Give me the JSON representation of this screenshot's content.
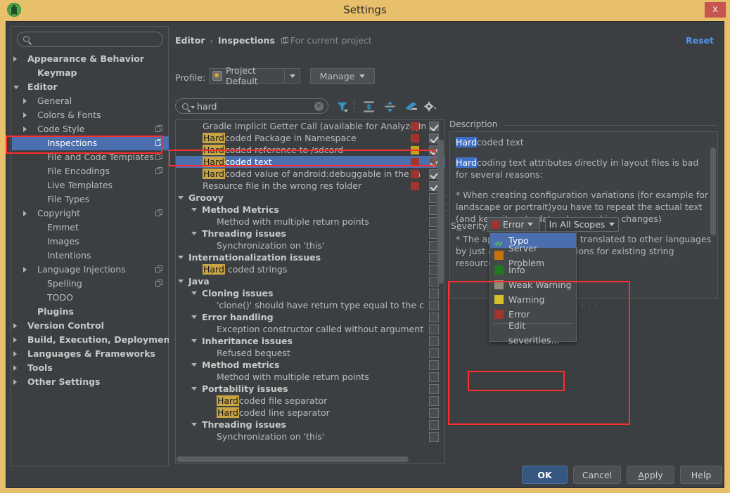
{
  "window": {
    "title": "Settings",
    "close_label": "x",
    "app_icon": "android-studio-icon"
  },
  "sidebar": {
    "search_placeholder": "",
    "items": [
      {
        "label": "Appearance & Behavior",
        "level": 0,
        "arrow": "right",
        "bold": true,
        "copy": false,
        "selected": false
      },
      {
        "label": "Keymap",
        "level": 1,
        "arrow": "",
        "bold": true,
        "copy": false,
        "selected": false
      },
      {
        "label": "Editor",
        "level": 0,
        "arrow": "down",
        "bold": true,
        "copy": false,
        "selected": false
      },
      {
        "label": "General",
        "level": 1,
        "arrow": "right",
        "bold": false,
        "copy": false,
        "selected": false
      },
      {
        "label": "Colors & Fonts",
        "level": 1,
        "arrow": "right",
        "bold": false,
        "copy": false,
        "selected": false
      },
      {
        "label": "Code Style",
        "level": 1,
        "arrow": "right",
        "bold": false,
        "copy": true,
        "selected": false
      },
      {
        "label": "Inspections",
        "level": 2,
        "arrow": "",
        "bold": false,
        "copy": true,
        "selected": true
      },
      {
        "label": "File and Code Templates",
        "level": 2,
        "arrow": "",
        "bold": false,
        "copy": true,
        "selected": false
      },
      {
        "label": "File Encodings",
        "level": 2,
        "arrow": "",
        "bold": false,
        "copy": true,
        "selected": false
      },
      {
        "label": "Live Templates",
        "level": 2,
        "arrow": "",
        "bold": false,
        "copy": false,
        "selected": false
      },
      {
        "label": "File Types",
        "level": 2,
        "arrow": "",
        "bold": false,
        "copy": false,
        "selected": false
      },
      {
        "label": "Copyright",
        "level": 1,
        "arrow": "right",
        "bold": false,
        "copy": true,
        "selected": false
      },
      {
        "label": "Emmet",
        "level": 2,
        "arrow": "",
        "bold": false,
        "copy": false,
        "selected": false
      },
      {
        "label": "Images",
        "level": 2,
        "arrow": "",
        "bold": false,
        "copy": false,
        "selected": false
      },
      {
        "label": "Intentions",
        "level": 2,
        "arrow": "",
        "bold": false,
        "copy": false,
        "selected": false
      },
      {
        "label": "Language Injections",
        "level": 1,
        "arrow": "right",
        "bold": false,
        "copy": true,
        "selected": false
      },
      {
        "label": "Spelling",
        "level": 2,
        "arrow": "",
        "bold": false,
        "copy": true,
        "selected": false
      },
      {
        "label": "TODO",
        "level": 2,
        "arrow": "",
        "bold": false,
        "copy": false,
        "selected": false
      },
      {
        "label": "Plugins",
        "level": 1,
        "arrow": "",
        "bold": true,
        "copy": false,
        "selected": false
      },
      {
        "label": "Version Control",
        "level": 0,
        "arrow": "right",
        "bold": true,
        "copy": false,
        "selected": false
      },
      {
        "label": "Build, Execution, Deployment",
        "level": 0,
        "arrow": "right",
        "bold": true,
        "copy": false,
        "selected": false
      },
      {
        "label": "Languages & Frameworks",
        "level": 0,
        "arrow": "right",
        "bold": true,
        "copy": false,
        "selected": false
      },
      {
        "label": "Tools",
        "level": 0,
        "arrow": "right",
        "bold": true,
        "copy": false,
        "selected": false
      },
      {
        "label": "Other Settings",
        "level": 0,
        "arrow": "right",
        "bold": true,
        "copy": false,
        "selected": false
      }
    ]
  },
  "main": {
    "breadcrumb": {
      "root": "Editor",
      "separator": "›",
      "current": "Inspections",
      "scope": "For current project"
    },
    "reset_label": "Reset",
    "profile": {
      "label": "Profile:",
      "value": "Project Default",
      "manage_label": "Manage"
    },
    "search": {
      "value": "hard",
      "clear_label": "✕"
    },
    "toolbar_icons": [
      "filter-icon",
      "expand-all-icon",
      "collapse-all-icon",
      "eraser-icon",
      "gear-icon"
    ]
  },
  "inspection_tree": [
    {
      "label": "Gradle Implicit Getter Call (available for Analyze|In",
      "indent": 38,
      "group": false,
      "arrow": "",
      "hl": "",
      "sev": "#a0342f",
      "check": "on",
      "selected": false
    },
    {
      "label": "coded Package in Namespace",
      "indent": 38,
      "group": false,
      "arrow": "",
      "hl": "Hard",
      "sev": "#a0342f",
      "check": "on",
      "selected": false
    },
    {
      "label": "coded reference to /sdcard",
      "indent": 38,
      "group": false,
      "arrow": "",
      "hl": "Hard",
      "sev": "#c9a21e",
      "check": "on",
      "selected": false
    },
    {
      "label": "coded text",
      "indent": 38,
      "group": false,
      "arrow": "",
      "hl": "Hard",
      "sev": "#a0342f",
      "check": "on",
      "selected": true
    },
    {
      "label": "coded value of android:debuggable in the m",
      "indent": 38,
      "group": false,
      "arrow": "",
      "hl": "Hard",
      "sev": "#a0342f",
      "check": "on",
      "selected": false
    },
    {
      "label": "Resource file in the wrong res folder",
      "indent": 38,
      "group": false,
      "arrow": "",
      "hl": "",
      "sev": "#a0342f",
      "check": "on",
      "selected": false
    },
    {
      "label": "Groovy",
      "indent": 18,
      "group": true,
      "arrow": "down",
      "hl": "",
      "sev": "",
      "check": "off",
      "selected": false
    },
    {
      "label": "Method Metrics",
      "indent": 37,
      "group": true,
      "arrow": "down",
      "hl": "",
      "sev": "",
      "check": "off",
      "selected": false
    },
    {
      "label": "Method with multiple return points",
      "indent": 58,
      "group": false,
      "arrow": "",
      "hl": "",
      "sev": "",
      "check": "off",
      "selected": false
    },
    {
      "label": "Threading issues",
      "indent": 37,
      "group": true,
      "arrow": "down",
      "hl": "",
      "sev": "",
      "check": "off",
      "selected": false
    },
    {
      "label": "Synchronization on 'this'",
      "indent": 58,
      "group": false,
      "arrow": "",
      "hl": "",
      "sev": "",
      "check": "off",
      "selected": false
    },
    {
      "label": "Internationalization issues",
      "indent": 18,
      "group": true,
      "arrow": "down",
      "hl": "",
      "sev": "",
      "check": "off",
      "selected": false
    },
    {
      "label": " coded strings",
      "indent": 38,
      "group": false,
      "arrow": "",
      "hl": "Hard",
      "sev": "",
      "check": "off",
      "selected": false
    },
    {
      "label": "Java",
      "indent": 18,
      "group": true,
      "arrow": "down",
      "hl": "",
      "sev": "",
      "check": "off",
      "selected": false
    },
    {
      "label": "Cloning issues",
      "indent": 37,
      "group": true,
      "arrow": "down",
      "hl": "",
      "sev": "",
      "check": "off",
      "selected": false
    },
    {
      "label": "'clone()' should have return type equal to the c",
      "indent": 58,
      "group": false,
      "arrow": "",
      "hl": "",
      "sev": "",
      "check": "off",
      "selected": false
    },
    {
      "label": "Error handling",
      "indent": 37,
      "group": true,
      "arrow": "down",
      "hl": "",
      "sev": "",
      "check": "off",
      "selected": false
    },
    {
      "label": "Exception constructor called without argument",
      "indent": 58,
      "group": false,
      "arrow": "",
      "hl": "",
      "sev": "",
      "check": "off",
      "selected": false
    },
    {
      "label": "Inheritance issues",
      "indent": 37,
      "group": true,
      "arrow": "down",
      "hl": "",
      "sev": "",
      "check": "off",
      "selected": false
    },
    {
      "label": "Refused bequest",
      "indent": 58,
      "group": false,
      "arrow": "",
      "hl": "",
      "sev": "",
      "check": "off",
      "selected": false
    },
    {
      "label": "Method metrics",
      "indent": 37,
      "group": true,
      "arrow": "down",
      "hl": "",
      "sev": "",
      "check": "off",
      "selected": false
    },
    {
      "label": "Method with multiple return points",
      "indent": 58,
      "group": false,
      "arrow": "",
      "hl": "",
      "sev": "",
      "check": "off",
      "selected": false
    },
    {
      "label": "Portability issues",
      "indent": 37,
      "group": true,
      "arrow": "down",
      "hl": "",
      "sev": "",
      "check": "off",
      "selected": false
    },
    {
      "label": "coded file separator",
      "indent": 58,
      "group": false,
      "arrow": "",
      "hl": "Hard",
      "sev": "",
      "check": "off",
      "selected": false
    },
    {
      "label": "coded line separator",
      "indent": 58,
      "group": false,
      "arrow": "",
      "hl": "Hard",
      "sev": "",
      "check": "off",
      "selected": false
    },
    {
      "label": "Threading issues",
      "indent": 37,
      "group": true,
      "arrow": "down",
      "hl": "",
      "sev": "",
      "check": "off",
      "selected": false
    },
    {
      "label": "Synchronization on 'this'",
      "indent": 58,
      "group": false,
      "arrow": "",
      "hl": "",
      "sev": "",
      "check": "off",
      "selected": false
    }
  ],
  "description": {
    "title": "Description",
    "heading_hl": "Hard",
    "heading_rest": "coded text",
    "p1_hl": "Hard",
    "p1_rest": "coding text attributes directly in layout files is bad for several reasons:",
    "p2": "* When creating configuration variations (for example for landscape or portrait)you have to repeat the actual text (and keep it up to date when making changes)",
    "p3": "* The application cannot be translated to other languages by just adding new translations for existing string resources."
  },
  "severity": {
    "label_prefix": "S",
    "label_underline": "e",
    "label_suffix": "verity:",
    "selected": "Error",
    "selected_color": "#a0342f",
    "scope": "In All Scopes",
    "options": [
      {
        "label": "Typo",
        "color": "#5ab55a",
        "icon": "typo-icon",
        "selected": true,
        "highlighted": false
      },
      {
        "label": "Server Problem",
        "color": "#c4710e",
        "icon": "swatch",
        "selected": false,
        "highlighted": false
      },
      {
        "label": "Info",
        "color": "#1f7a1f",
        "icon": "swatch",
        "selected": false,
        "highlighted": false
      },
      {
        "label": "Weak Warning",
        "color": "#938f76",
        "icon": "swatch",
        "selected": false,
        "highlighted": false
      },
      {
        "label": "Warning",
        "color": "#d4c02c",
        "icon": "swatch",
        "selected": false,
        "highlighted": false
      },
      {
        "label": "Error",
        "color": "#a0342f",
        "icon": "swatch",
        "selected": false,
        "highlighted": true
      }
    ],
    "edit_label": "Edit severities..."
  },
  "buttons": {
    "ok": "OK",
    "cancel": "Cancel",
    "apply_prefix": "",
    "apply_underline": "A",
    "apply_suffix": "pply",
    "help": "Help"
  },
  "colors": {
    "accent": "#4b6eaf",
    "window_frame": "#e8bf6a",
    "annotation": "#ff2d2d",
    "link": "#5394ec"
  }
}
